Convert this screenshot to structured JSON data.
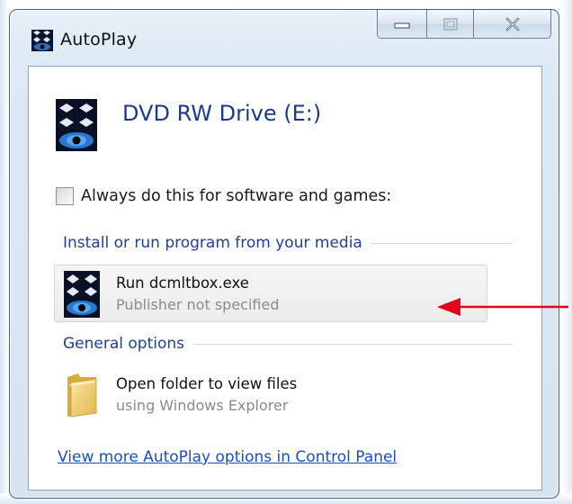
{
  "window": {
    "title": "AutoPlay",
    "controls": [
      "minimize-icon",
      "maximize-icon",
      "close-icon"
    ]
  },
  "device": {
    "name": "DVD RW Drive (E:)",
    "icon": "eye-device-icon"
  },
  "always_checkbox": {
    "label": "Always do this for software and games:",
    "checked": false
  },
  "groups": {
    "install": {
      "header": "Install or run program from your media",
      "option": {
        "title": "Run dcmltbox.exe",
        "subtitle": "Publisher not specified",
        "icon": "eye-app-icon"
      }
    },
    "general": {
      "header": "General options",
      "option": {
        "title": "Open folder to view files",
        "subtitle": "using Windows Explorer",
        "icon": "folder-icon"
      }
    }
  },
  "control_panel_link": "View more AutoPlay options in Control Panel",
  "annotation": {
    "color": "#e3001b",
    "icon": "red-arrow-icon"
  },
  "colors": {
    "heading_blue": "#1b3a8c",
    "group_blue": "#1e3f98",
    "link_blue": "#1a4fbd"
  }
}
